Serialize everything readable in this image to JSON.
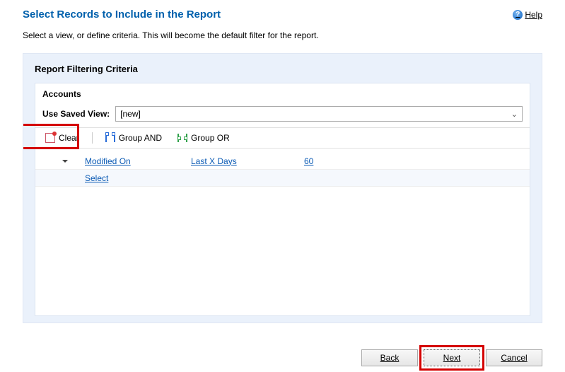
{
  "header": {
    "title": "Select Records to Include in the Report",
    "help": "Help"
  },
  "instruction": "Select a view, or define criteria. This will become the default filter for the report.",
  "panel": {
    "title": "Report Filtering Criteria",
    "entity": "Accounts",
    "view": {
      "label": "Use Saved View:",
      "value": "[new]"
    },
    "toolbar": {
      "clear": "Clear",
      "group_and": "Group AND",
      "group_or": "Group OR"
    },
    "criteria": {
      "rows": [
        {
          "field": "Modified On",
          "op": "Last X Days",
          "val": "60"
        }
      ],
      "select_label": "Select"
    }
  },
  "footer": {
    "back": "Back",
    "next": "Next",
    "cancel": "Cancel"
  }
}
